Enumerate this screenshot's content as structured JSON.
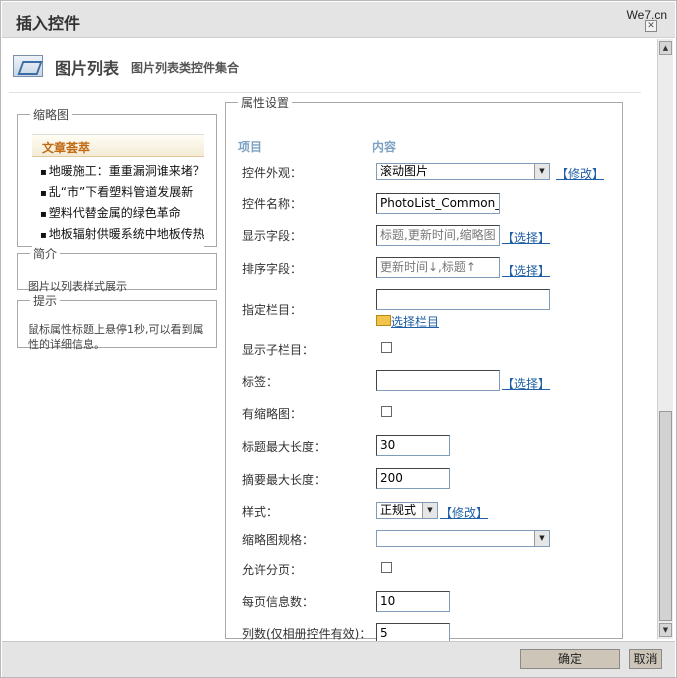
{
  "window": {
    "title": "插入控件",
    "watermark": "We7.cn"
  },
  "header": {
    "title": "图片列表",
    "subtitle": "图片列表类控件集合"
  },
  "thumbnail": {
    "legend": "缩略图",
    "preview_title": "文章荟萃",
    "preview_items": [
      "地暖施工：重重漏洞谁来堵？",
      "乱“市”下看塑料管道发展新",
      "塑料代替金属的绿色革命",
      "地板辐射供暖系统中地板传热"
    ]
  },
  "intro": {
    "legend": "简介",
    "text": "图片以列表样式展示"
  },
  "tip": {
    "legend": "提示",
    "text": "鼠标属性标题上悬停1秒,可以看到属性的详细信息。"
  },
  "props": {
    "legend": "属性设置",
    "col_item": "项目",
    "col_content": "内容",
    "modify_link": "【修改】",
    "select_link": "【选择】",
    "rows": {
      "appearance": {
        "label": "控件外观：",
        "value": "滚动图片"
      },
      "name": {
        "label": "控件名称：",
        "value": "PhotoList_Common_0"
      },
      "display_fields": {
        "label": "显示字段：",
        "value": "标题,更新时间,缩略图"
      },
      "sort_fields": {
        "label": "排序字段：",
        "value": "更新时间↓,标题↑"
      },
      "column": {
        "label": "指定栏目：",
        "value": "",
        "link": "选择栏目"
      },
      "show_sub": {
        "label": "显示子栏目："
      },
      "tags": {
        "label": "标签：",
        "value": ""
      },
      "has_thumb": {
        "label": "有缩略图："
      },
      "title_max": {
        "label": "标题最大长度：",
        "value": "30"
      },
      "summary_max": {
        "label": "摘要最大长度：",
        "value": "200"
      },
      "style": {
        "label": "样式：",
        "value": "正规式"
      },
      "thumb_spec": {
        "label": "缩略图规格：",
        "value": ""
      },
      "paging": {
        "label": "允许分页："
      },
      "page_size": {
        "label": "每页信息数：",
        "value": "10"
      },
      "columns": {
        "label": "列数(仅相册控件有效)：",
        "value": "5"
      }
    }
  },
  "footer": {
    "ok": "确定",
    "cancel": "取消"
  },
  "icons": {
    "close": "close-icon",
    "dropdown": "chevron-down-icon",
    "folder": "folder-icon",
    "header": "image-list-icon",
    "scroll_up": "arrow-up-icon",
    "scroll_down": "arrow-down-icon"
  },
  "colors": {
    "link": "#1f5fa6",
    "column_header": "#7da2c2",
    "preview_title": "#c06a12",
    "titlebar": "#e4e4e4"
  }
}
